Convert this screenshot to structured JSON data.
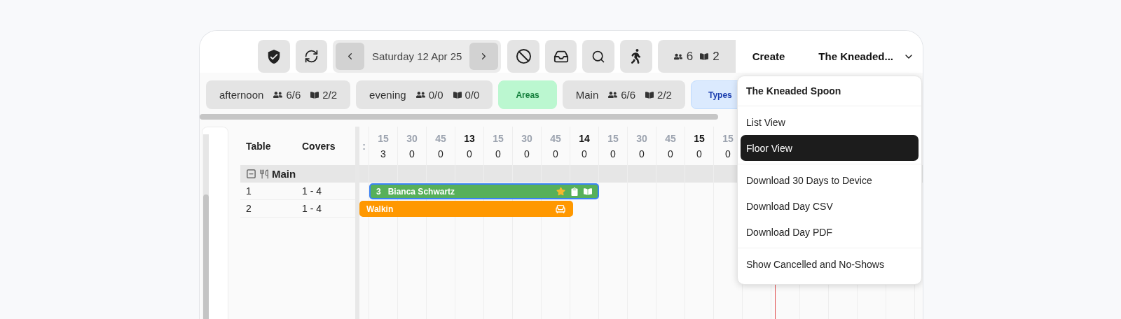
{
  "toolbar": {
    "date": "Saturday 12 Apr 25",
    "totals": {
      "covers": "6",
      "bookings": "2"
    },
    "create": "Create",
    "venue": {
      "label": "The Kneaded...",
      "expanded": true
    }
  },
  "filters": [
    {
      "kind": "stat",
      "label": "afternoon",
      "covers": "6/6",
      "bookings": "2/2"
    },
    {
      "kind": "stat",
      "label": "evening",
      "covers": "0/0",
      "bookings": "0/0"
    },
    {
      "kind": "toggle",
      "label": "Areas",
      "color": "#bbf7d0"
    },
    {
      "kind": "stat",
      "label": "Main",
      "covers": "6/6",
      "bookings": "2/2"
    },
    {
      "kind": "toggle",
      "label": "Types",
      "color": "#dbeafe"
    }
  ],
  "table": {
    "columns": [
      "Table",
      "Covers"
    ],
    "group": {
      "name": "Main",
      "expanded": true
    },
    "rows": [
      {
        "table": "1",
        "covers": "1 - 4",
        "booking": {
          "kind": "reservation",
          "covers": "3",
          "name": "Bianca Schwartz",
          "selected": true
        }
      },
      {
        "table": "2",
        "covers": "1 - 4",
        "booking": {
          "kind": "walkin",
          "name": "Walkin",
          "selected": false
        }
      }
    ]
  },
  "timeline": {
    "slots": [
      {
        "label": ":",
        "hour": false
      },
      {
        "label": "15",
        "hour": false,
        "count": "3"
      },
      {
        "label": "30",
        "hour": false,
        "count": "0"
      },
      {
        "label": "45",
        "hour": false,
        "count": "0"
      },
      {
        "label": "13",
        "hour": true,
        "count": "0"
      },
      {
        "label": "15",
        "hour": false,
        "count": "0"
      },
      {
        "label": "30",
        "hour": false,
        "count": "0"
      },
      {
        "label": "45",
        "hour": false,
        "count": "0"
      },
      {
        "label": "14",
        "hour": true,
        "count": "0"
      },
      {
        "label": "15",
        "hour": false,
        "count": "0"
      },
      {
        "label": "30",
        "hour": false,
        "count": "0"
      },
      {
        "label": "45",
        "hour": false,
        "count": "0"
      },
      {
        "label": "15",
        "hour": true,
        "count": "0"
      },
      {
        "label": "15",
        "hour": false,
        "count": "0"
      }
    ]
  },
  "menu": {
    "title": "The Kneaded Spoon",
    "sections": [
      [
        {
          "label": "List View",
          "selected": false
        },
        {
          "label": "Floor View",
          "selected": true
        }
      ],
      [
        {
          "label": "Download 30 Days to Device",
          "selected": false
        },
        {
          "label": "Download Day CSV",
          "selected": false
        },
        {
          "label": "Download Day PDF",
          "selected": false
        }
      ],
      [
        {
          "label": "Show Cancelled and No-Shows",
          "selected": false
        }
      ]
    ]
  }
}
